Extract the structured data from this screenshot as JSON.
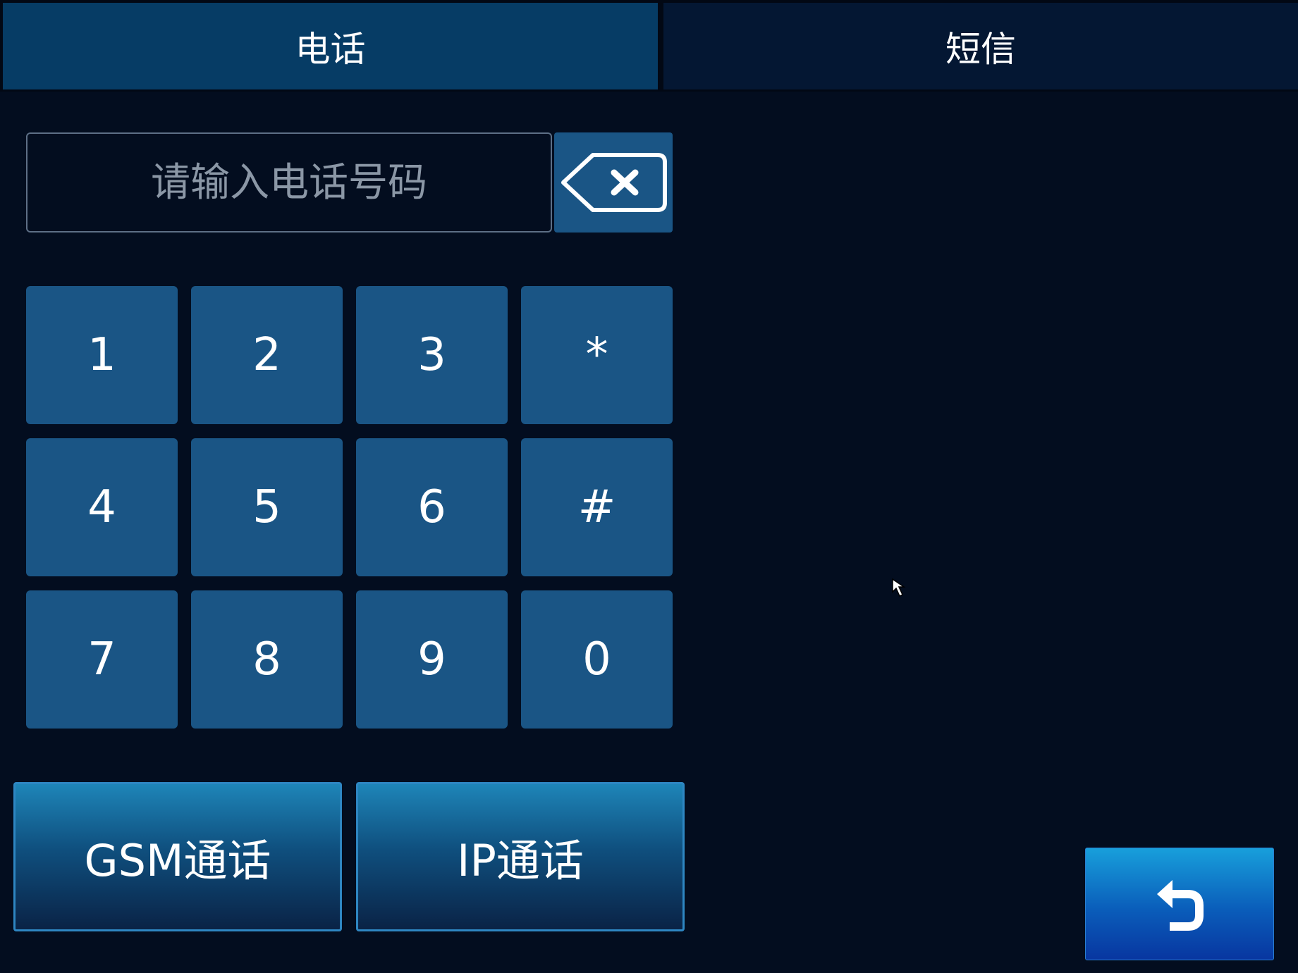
{
  "tabs": [
    {
      "label": "电话",
      "active": true
    },
    {
      "label": "短信",
      "active": false
    }
  ],
  "phone_input": {
    "value": "",
    "placeholder": "请输入电话号码"
  },
  "backspace_icon": "backspace-icon",
  "keypad": {
    "keys": [
      "1",
      "2",
      "3",
      "*",
      "4",
      "5",
      "6",
      "#",
      "7",
      "8",
      "9",
      "0"
    ]
  },
  "call_buttons": {
    "gsm_label": "GSM通话",
    "ip_label": "IP通话"
  },
  "back_icon": "return-arrow-icon",
  "colors": {
    "background": "#030d1f",
    "tab_active": "#063c65",
    "tab_inactive": "#041733",
    "key": "#1a5585",
    "back_button": "#0a5dba"
  }
}
